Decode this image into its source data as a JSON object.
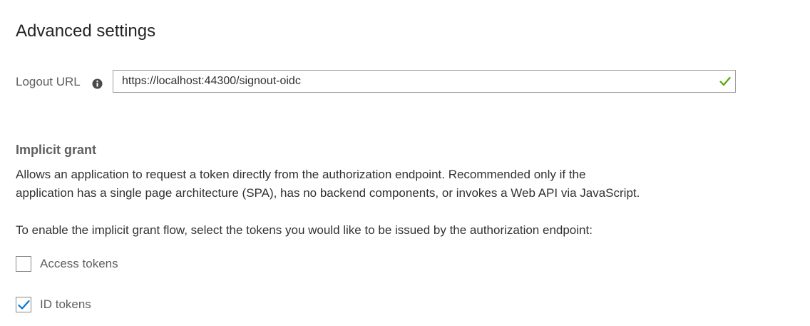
{
  "page": {
    "title": "Advanced settings"
  },
  "logout": {
    "label": "Logout URL",
    "value": "https://localhost:44300/signout-oidc",
    "valid": true
  },
  "implicit_grant": {
    "heading": "Implicit grant",
    "description_line1": "Allows an application to request a token directly from the authorization endpoint. Recommended only if the",
    "description_line2": "application has a single page architecture (SPA), has no backend components, or invokes a Web API via JavaScript.",
    "instruction": "To enable the implicit grant flow, select the tokens you would like to be issued by the authorization endpoint:",
    "options": [
      {
        "label": "Access tokens",
        "checked": false
      },
      {
        "label": "ID tokens",
        "checked": true
      }
    ]
  },
  "colors": {
    "accent": "#0078d4",
    "success": "#57a300",
    "text": "#323130",
    "muted": "#605e5c"
  },
  "icons": {
    "info": "info-icon",
    "valid": "checkmark-icon",
    "checkbox_check": "checkmark-icon"
  }
}
